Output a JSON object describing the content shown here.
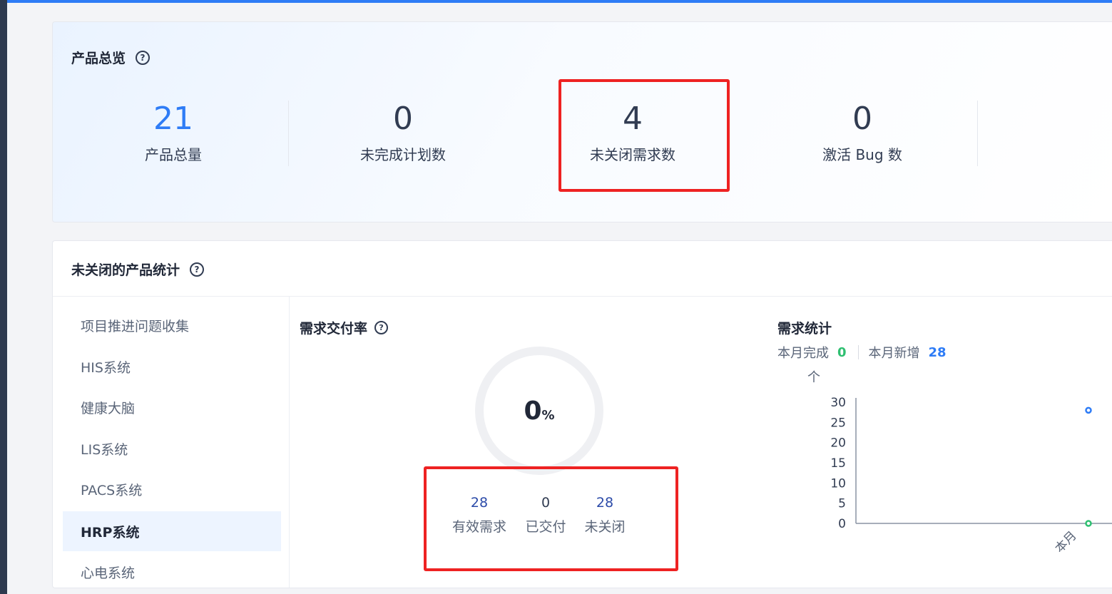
{
  "overview": {
    "title": "产品总览",
    "help_icon": "?",
    "stats": [
      {
        "value": "21",
        "label": "产品总量"
      },
      {
        "value": "0",
        "label": "未完成计划数"
      },
      {
        "value": "4",
        "label": "未关闭需求数"
      },
      {
        "value": "0",
        "label": "激活 Bug 数"
      }
    ]
  },
  "products": {
    "title": "未关闭的产品统计",
    "help_icon": "?",
    "sidebar": [
      {
        "label": "项目推进问题收集"
      },
      {
        "label": "HIS系统"
      },
      {
        "label": "健康大脑"
      },
      {
        "label": "LIS系统"
      },
      {
        "label": "PACS系统"
      },
      {
        "label": "HRP系统",
        "active": true
      },
      {
        "label": "心电系统"
      }
    ],
    "delivery": {
      "title": "需求交付率",
      "help_icon": "?",
      "rate": "0",
      "rate_unit": "%",
      "items": [
        {
          "value": "28",
          "label": "有效需求"
        },
        {
          "value": "0",
          "label": "已交付"
        },
        {
          "value": "28",
          "label": "未关闭"
        }
      ]
    },
    "req_stats": {
      "title": "需求统计",
      "month_done_label": "本月完成",
      "month_done_value": "0",
      "month_new_label": "本月新增",
      "month_new_value": "28"
    }
  },
  "chart_data": {
    "type": "line",
    "ylabel": "个",
    "categories": [
      "本月"
    ],
    "yticks": [
      "30",
      "25",
      "20",
      "15",
      "10",
      "5",
      "0"
    ],
    "ylim": [
      0,
      30
    ],
    "series": [
      {
        "values": [
          28
        ],
        "color": "#2e7cf6"
      },
      {
        "values": [
          0
        ],
        "color": "#2fbf71"
      }
    ],
    "grid": false
  },
  "colors": {
    "accent": "#2e7cf6",
    "highlight_box": "#ee2222",
    "green": "#2fbf71"
  }
}
